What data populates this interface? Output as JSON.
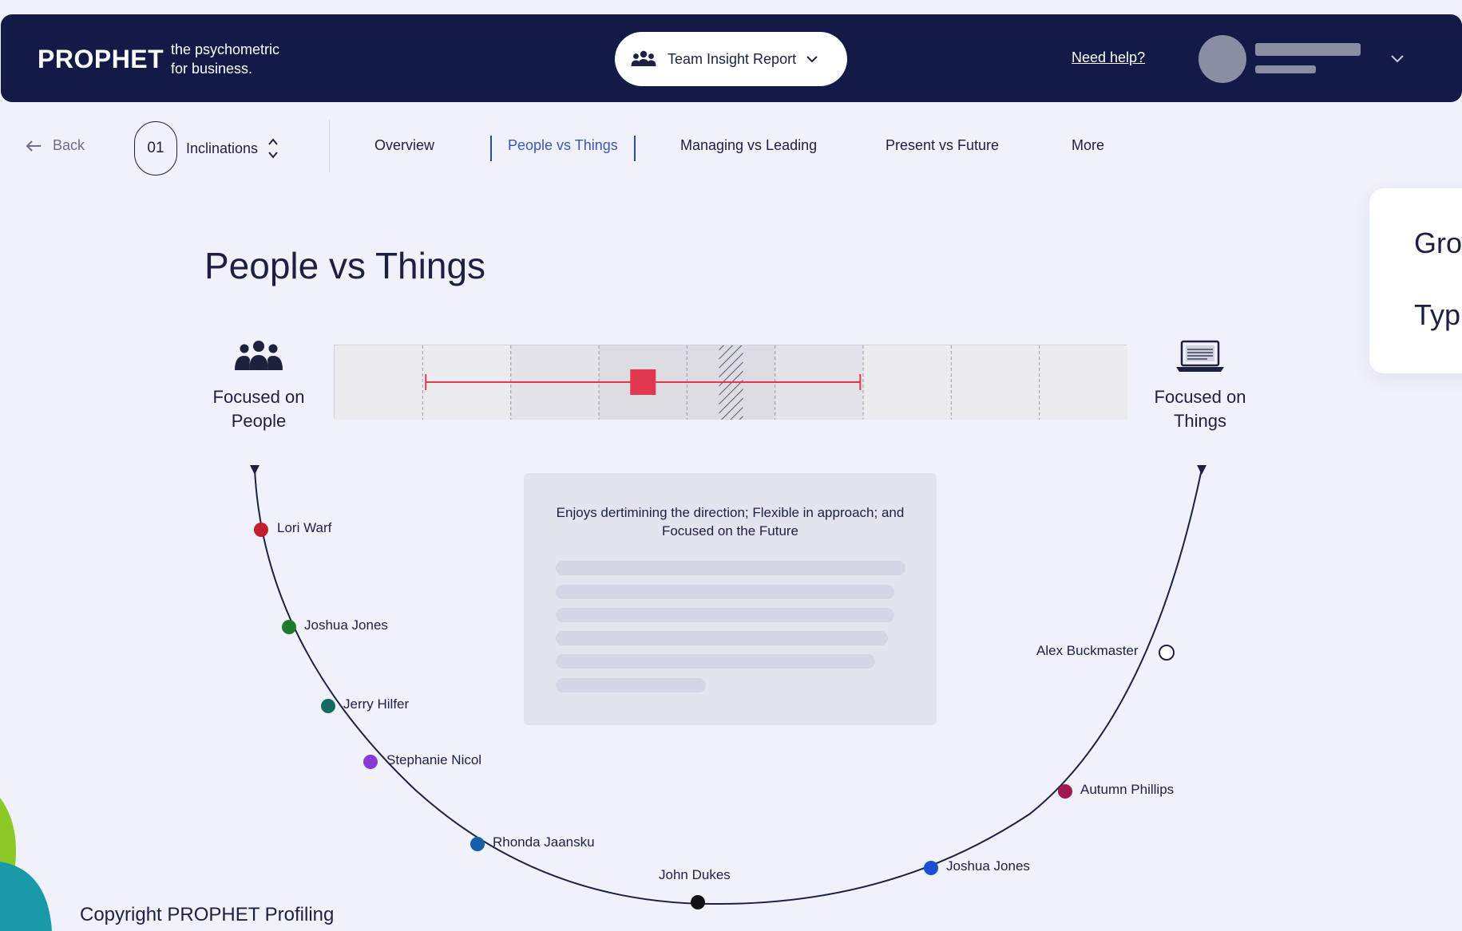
{
  "header": {
    "logo": "PROPHET",
    "tagline": "the psychometric for business.",
    "report_selector": "Team Insight Report",
    "help_link": "Need help?",
    "user_icon": "avatar",
    "user_menu_icon": "chevron-down-icon"
  },
  "nav": {
    "back_label": "Back",
    "step_number": "01",
    "section_label": "Inclinations",
    "tabs": [
      {
        "label": "Overview",
        "active": false
      },
      {
        "label": "People vs Things",
        "active": true
      },
      {
        "label": "Managing vs Leading",
        "active": false
      },
      {
        "label": "Present vs Future",
        "active": false
      },
      {
        "label": "More",
        "active": false
      }
    ]
  },
  "side_card": {
    "line1": "Gro",
    "line2": "Typ"
  },
  "main": {
    "title": "People vs Things",
    "left_pole": {
      "line1": "Focused on",
      "line2": "People",
      "icon": "people-group-icon"
    },
    "right_pole": {
      "line1": "Focused on",
      "line2": "Things",
      "icon": "laptop-icon"
    },
    "scale": {
      "segments": 9,
      "range_start_fraction": 0.115,
      "range_end_fraction": 0.663,
      "marker_fraction": 0.389,
      "hatched_fraction": 0.5,
      "range_color": "#e2384f"
    },
    "description": "Enjoys dertimining the direction; Flexible in approach; and Focused on the Future"
  },
  "team_members": [
    {
      "name": "Lori Warf",
      "color": "#c0202e",
      "side": "left"
    },
    {
      "name": "Joshua Jones",
      "color": "#1e7a2c",
      "side": "left"
    },
    {
      "name": "Jerry Hilfer",
      "color": "#136b63",
      "side": "left"
    },
    {
      "name": "Stephanie Nicol",
      "color": "#8a38d6",
      "side": "left"
    },
    {
      "name": "Rhonda Jaansku",
      "color": "#175da8",
      "side": "left"
    },
    {
      "name": "John Dukes",
      "color": "#111111",
      "side": "bottom"
    },
    {
      "name": "Joshua Jones",
      "color": "#1d4fd6",
      "side": "right"
    },
    {
      "name": "Autumn Phillips",
      "color": "#a11a4d",
      "side": "right"
    },
    {
      "name": "Alex Buckmaster",
      "color": "#ffffff",
      "side": "right"
    }
  ],
  "footer": {
    "copyright": "Copyright PROPHET Profiling"
  },
  "colors": {
    "header_bg": "#121a47",
    "accent": "#3a56b8",
    "page_bg": "#f0f1fb"
  }
}
